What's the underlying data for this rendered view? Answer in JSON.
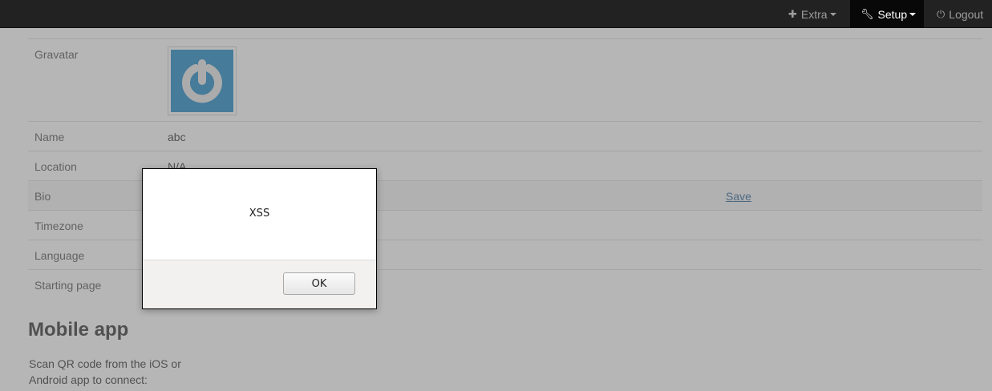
{
  "navbar": {
    "extra": {
      "label": "Extra",
      "icon": "plus-icon"
    },
    "setup": {
      "label": "Setup",
      "icon": "wrench-icon"
    },
    "logout": {
      "label": "Logout",
      "icon": "power-icon"
    }
  },
  "profile": {
    "gravatar_label": "Gravatar",
    "name_label": "Name",
    "name_value": "abc",
    "location_label": "Location",
    "location_value": "N/A",
    "bio_label": "Bio",
    "save_label": "Save",
    "timezone_label": "Timezone",
    "language_label": "Language",
    "starting_page_label": "Starting page"
  },
  "mobile": {
    "heading": "Mobile app",
    "description": "Scan QR code from the iOS or Android app to connect:"
  },
  "dialog": {
    "message": "XSS",
    "ok_label": "OK"
  },
  "colors": {
    "navbar_bg": "#222222",
    "gravatar_blue": "#1e88c7",
    "link": "#2a6496"
  }
}
